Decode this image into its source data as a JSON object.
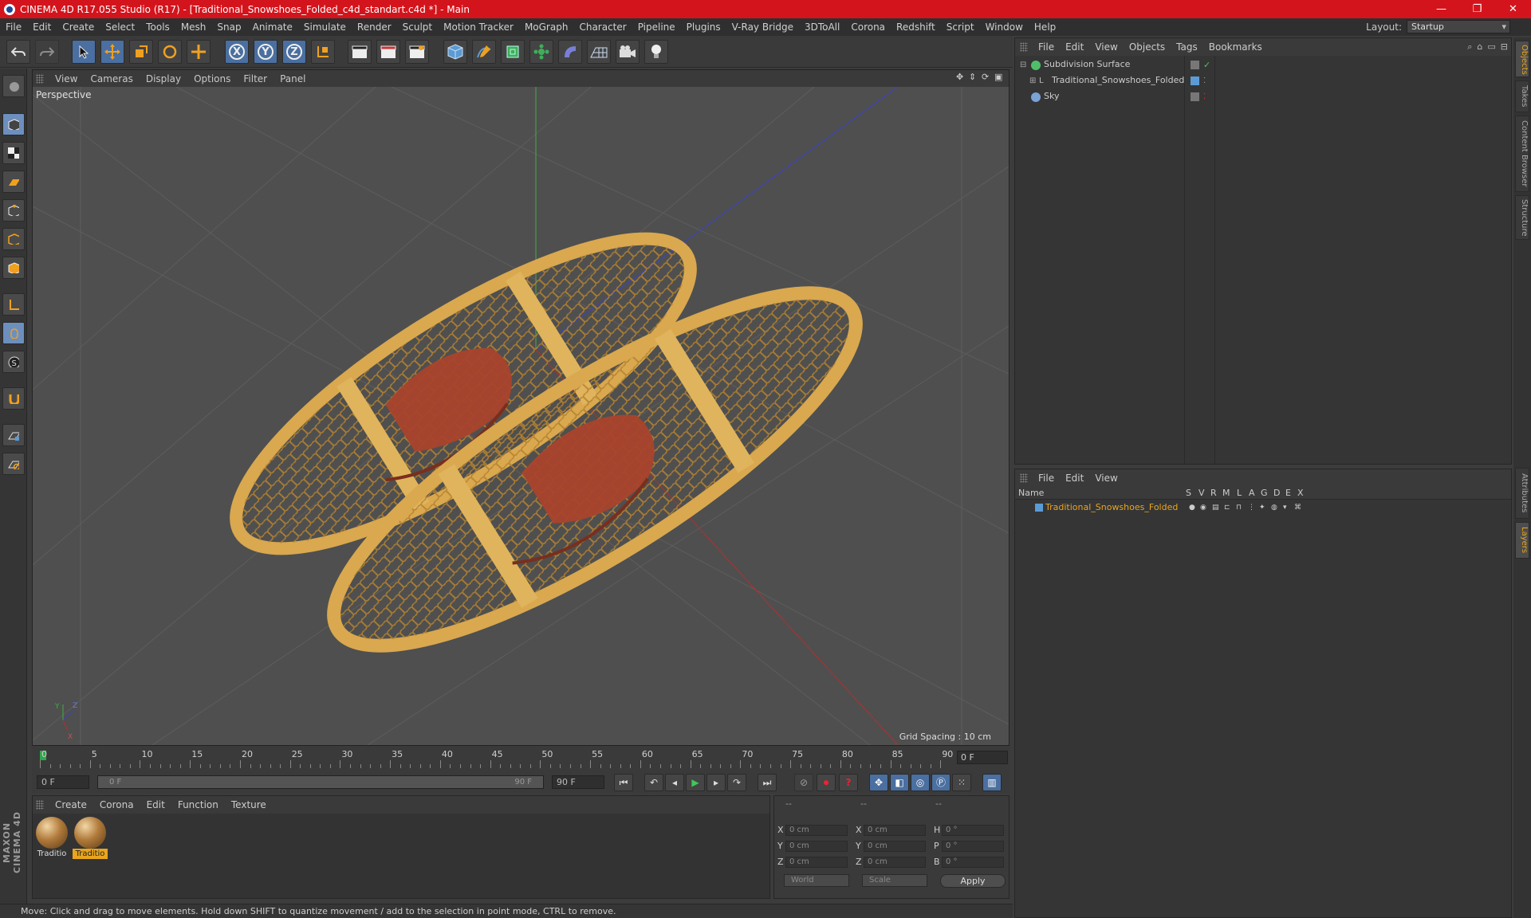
{
  "window": {
    "title": "CINEMA 4D R17.055 Studio (R17) - [Traditional_Snowshoes_Folded_c4d_standart.c4d *] - Main",
    "minimize": "—",
    "maximize": "❐",
    "close": "✕"
  },
  "menu": {
    "items": [
      "File",
      "Edit",
      "Create",
      "Select",
      "Tools",
      "Mesh",
      "Snap",
      "Animate",
      "Simulate",
      "Render",
      "Sculpt",
      "Motion Tracker",
      "MoGraph",
      "Character",
      "Pipeline",
      "Plugins",
      "V-Ray Bridge",
      "3DToAll",
      "Corona",
      "Redshift",
      "Script",
      "Window",
      "Help"
    ],
    "layout_label": "Layout:",
    "layout_value": "Startup"
  },
  "toolbar": {
    "axis_x": "X",
    "axis_y": "Y",
    "axis_z": "Z"
  },
  "viewport": {
    "menu": [
      "View",
      "Cameras",
      "Display",
      "Options",
      "Filter",
      "Panel"
    ],
    "camera_label": "Perspective",
    "grid_spacing": "Grid Spacing : 10 cm",
    "axis_y": "Y",
    "axis_z": "Z",
    "axis_x": "X"
  },
  "timeline": {
    "ticks": [
      "0",
      "5",
      "10",
      "15",
      "20",
      "25",
      "30",
      "35",
      "40",
      "45",
      "50",
      "55",
      "60",
      "65",
      "70",
      "75",
      "80",
      "85",
      "90"
    ],
    "current_frame": "0 F"
  },
  "transport": {
    "start_field": "0 F",
    "range_start": "0 F",
    "range_end": "90 F",
    "end_field": "90 F"
  },
  "materials": {
    "menu": [
      "Create",
      "Corona",
      "Edit",
      "Function",
      "Texture"
    ],
    "items": [
      {
        "name": "Traditio",
        "selected": false
      },
      {
        "name": "Traditio",
        "selected": true
      }
    ]
  },
  "coords": {
    "header": [
      "--",
      "--",
      "--"
    ],
    "rows": [
      {
        "axis1": "X",
        "val1": "0 cm",
        "axis2": "X",
        "val2": "0 cm",
        "axis3": "H",
        "val3": "0 °"
      },
      {
        "axis1": "Y",
        "val1": "0 cm",
        "axis2": "Y",
        "val2": "0 cm",
        "axis3": "P",
        "val3": "0 °"
      },
      {
        "axis1": "Z",
        "val1": "0 cm",
        "axis2": "Z",
        "val2": "0 cm",
        "axis3": "B",
        "val3": "0 °"
      }
    ],
    "mode1": "World",
    "mode2": "Scale",
    "apply": "Apply"
  },
  "status": {
    "text": "Move: Click and drag to move elements. Hold down SHIFT to quantize movement / add to the selection in point mode, CTRL to remove."
  },
  "object_manager": {
    "menu": [
      "File",
      "Edit",
      "View",
      "Objects",
      "Tags",
      "Bookmarks"
    ],
    "objects": [
      {
        "name": "Subdivision Surface",
        "color": "#4fbf6a"
      },
      {
        "name": "Traditional_Snowshoes_Folded",
        "color": "#bbbbbb"
      },
      {
        "name": "Sky",
        "color": "#7aa3d6"
      }
    ]
  },
  "layer_manager": {
    "menu": [
      "File",
      "Edit",
      "View"
    ],
    "columns": [
      "Name",
      "S",
      "V",
      "R",
      "M",
      "L",
      "A",
      "G",
      "D",
      "E",
      "X"
    ],
    "layer_name": "Traditional_Snowshoes_Folded",
    "layer_color": "#5b9bd5"
  },
  "side_tabs": [
    "Objects",
    "Takes",
    "Content Browser",
    "Structure",
    "Attributes",
    "Layers"
  ],
  "logo": {
    "text": "MAXON CINEMA 4D"
  }
}
